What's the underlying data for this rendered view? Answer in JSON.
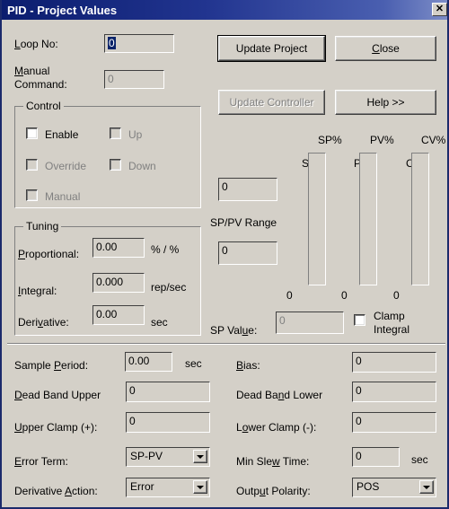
{
  "window": {
    "title": "PID - Project Values",
    "close_label": "✕"
  },
  "top": {
    "loop_no_label": "Loop No:",
    "loop_no_value": "0",
    "manual_label_line1": "Manual",
    "manual_label_line2": "Command:",
    "manual_value": "0"
  },
  "buttons": {
    "update_project": "Update Project",
    "close": "Close",
    "update_controller": "Update Controller",
    "help": "Help >>"
  },
  "control_group": {
    "title": "Control",
    "items": [
      {
        "label": "Enable",
        "checked": false,
        "enabled": true
      },
      {
        "label": "Up",
        "checked": false,
        "enabled": false
      },
      {
        "label": "Override",
        "checked": false,
        "enabled": false
      },
      {
        "label": "Down",
        "checked": false,
        "enabled": false
      },
      {
        "label": "Manual",
        "checked": false,
        "enabled": false
      }
    ]
  },
  "tuning_group": {
    "title": "Tuning",
    "proportional_label": "Proportional:",
    "proportional_value": "0.00",
    "proportional_units": "% / %",
    "integral_label": "Integral:",
    "integral_value": "0.000",
    "integral_units": "rep/sec",
    "derivative_label": "Derivative:",
    "derivative_value": "0.00",
    "derivative_units": "sec"
  },
  "meters": {
    "pct_labels": [
      "SP%",
      "PV%",
      "CV%"
    ],
    "bar_labels": [
      "SP",
      "PV",
      "CV"
    ],
    "bar_values": [
      "0",
      "0",
      "0"
    ],
    "sp_field_value": "0",
    "sp_pv_range_label": "SP/PV Range",
    "sp_pv_range_value": "0",
    "sp_value_label": "SP Value:",
    "sp_value_value": "0",
    "clamp_integral_label_line1": "Clamp",
    "clamp_integral_label_line2": "Integral",
    "clamp_integral_checked": false
  },
  "bottom_left": {
    "sample_period_label": "Sample Period:",
    "sample_period_value": "0.00",
    "sample_period_units": "sec",
    "dead_band_upper_label": "Dead Band Upper",
    "dead_band_upper_value": "0",
    "upper_clamp_label": "Upper Clamp (+):",
    "upper_clamp_value": "0",
    "error_term_label": "Error Term:",
    "error_term_value": "SP-PV",
    "derivative_action_label": "Derivative Action:",
    "derivative_action_value": "Error"
  },
  "bottom_right": {
    "bias_label": "Bias:",
    "bias_value": "0",
    "dead_band_lower_label": "Dead Band Lower",
    "dead_band_lower_value": "0",
    "lower_clamp_label": "Lower Clamp  (-):",
    "lower_clamp_value": "0",
    "min_slew_label": "Min Slew Time:",
    "min_slew_value": "0",
    "min_slew_units": "sec",
    "output_polarity_label": "Output Polarity:",
    "output_polarity_value": "POS"
  },
  "colors": {
    "face": "#d4d0c8",
    "title_start": "#0b1d6e",
    "title_end": "#7f8fc8",
    "selection": "#0a246a",
    "disabled_text": "#808080"
  }
}
